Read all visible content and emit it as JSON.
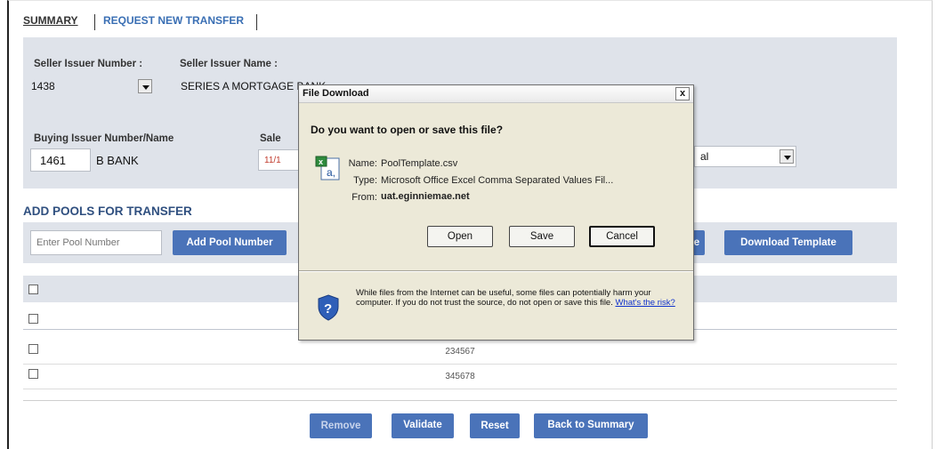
{
  "tabs": [
    {
      "label": "SUMMARY"
    },
    {
      "label": "REQUEST NEW TRANSFER"
    }
  ],
  "form": {
    "seller_issuer_number_label": "Seller Issuer Number :",
    "seller_issuer_number_value": "1438",
    "seller_issuer_name_label": "Seller Issuer Name :",
    "seller_issuer_name_value": "SERIES A MORTGAGE BANK",
    "buying_issuer_label": "Buying Issuer Number/Name",
    "buying_issuer_number": "1461",
    "buying_issuer_name": "B BANK",
    "sale_label_partial": "Sale",
    "sale_value_partial": "11/1",
    "right_select_value_partial": "al"
  },
  "pools": {
    "section_title": "ADD POOLS FOR TRANSFER",
    "input_placeholder": "Enter Pool Number",
    "add_button": "Add Pool Number",
    "hidden_button_partial": "e",
    "download_button": "Download Template",
    "rows": [
      "",
      "234567",
      "345678"
    ]
  },
  "footer_buttons": {
    "remove": "Remove",
    "validate": "Validate",
    "reset": "Reset",
    "back": "Back to Summary"
  },
  "dialog": {
    "title": "File Download",
    "close_glyph": "x",
    "question": "Do you want to open or save this file?",
    "name_label": "Name:",
    "name_value": "PoolTemplate.csv",
    "type_label": "Type:",
    "type_value": "Microsoft Office Excel Comma Separated Values Fil...",
    "from_label": "From:",
    "from_value": "uat.eginniemae.net",
    "open_button": "Open",
    "save_button": "Save",
    "cancel_button": "Cancel",
    "warning_text": "While files from the Internet can be useful, some files can potentially harm your computer. If you do not trust the source, do not open or save this file.",
    "risk_link": "What's the risk?"
  },
  "colors": {
    "panel_bg": "#dfe3ea",
    "button_blue": "#4a73b9",
    "link_blue": "#3a6fb4",
    "dialog_bg": "#ece9d8"
  }
}
